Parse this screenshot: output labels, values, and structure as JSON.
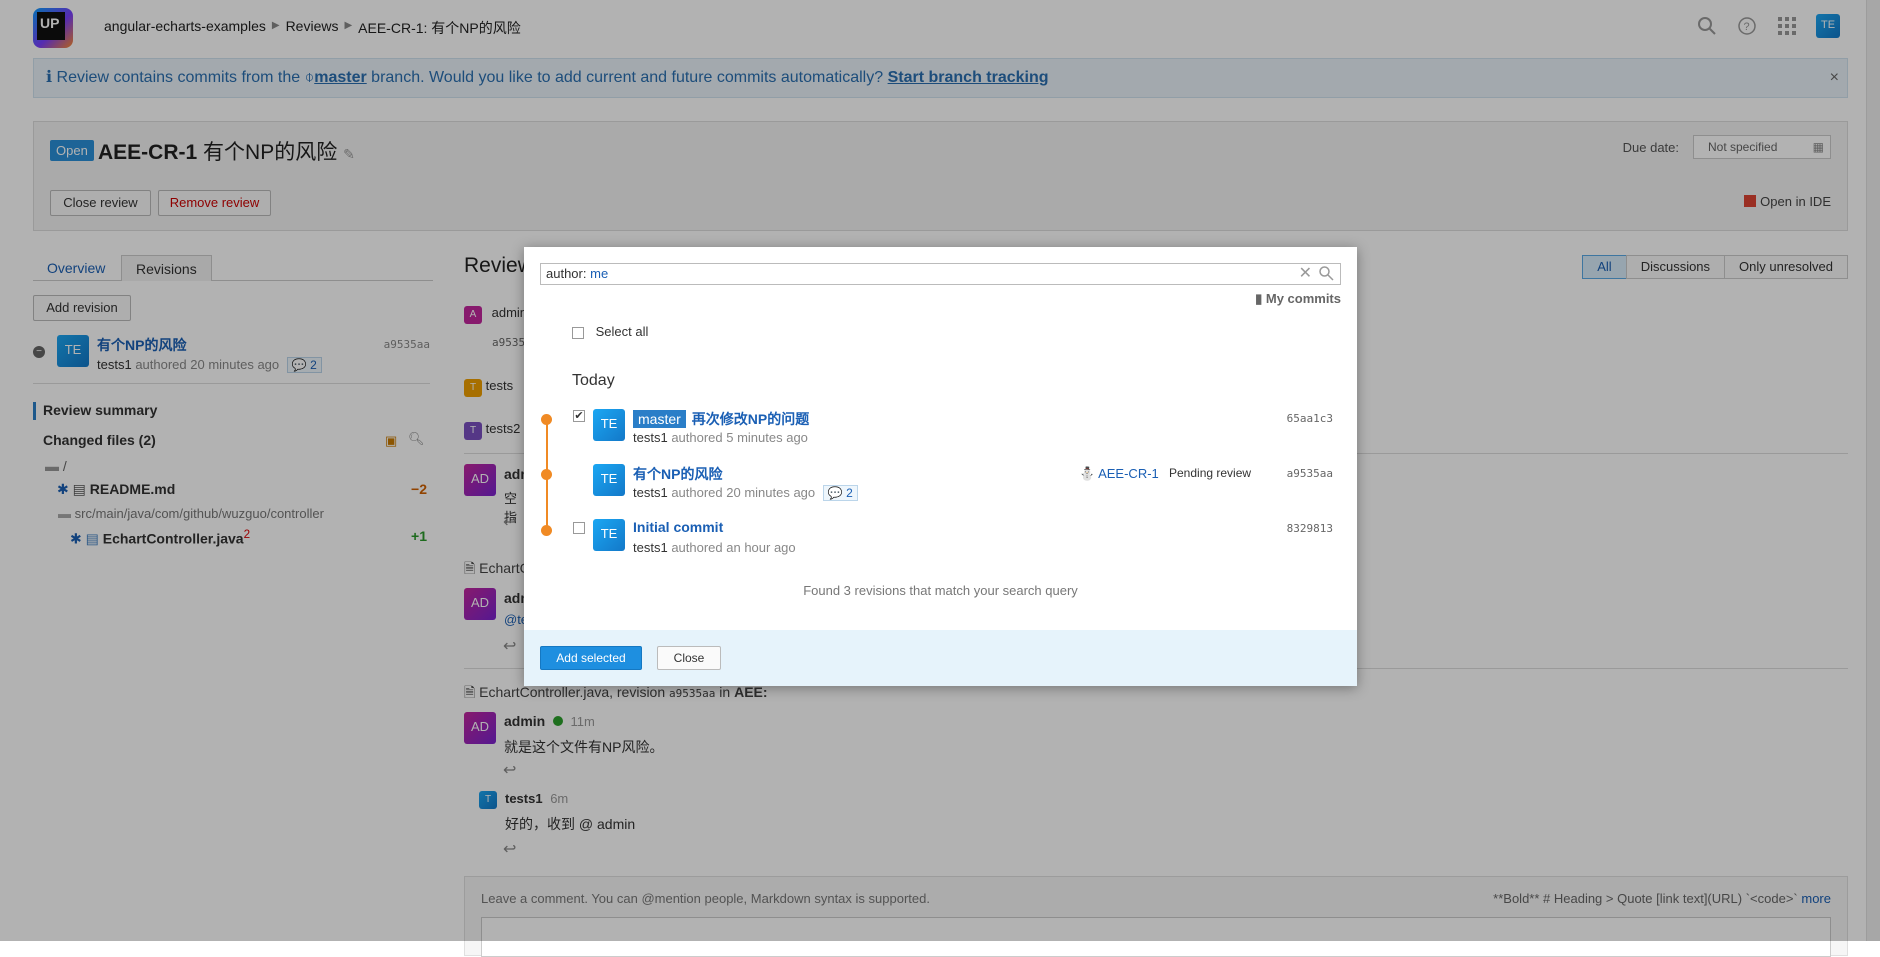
{
  "topbar": {
    "logo": "UP",
    "breadcrumb": [
      "angular-echarts-examples",
      "Reviews",
      "AEE-CR-1: 有个NP的风险"
    ],
    "user_avatar": "TE",
    "icons": [
      "search-icon",
      "help-icon",
      "apps-grid-icon"
    ]
  },
  "banner": {
    "text_before": "Review contains commits from the",
    "branch": "master",
    "text_after": "branch. Would you like to add current and future commits automatically?",
    "action": "Start branch tracking",
    "close": "×"
  },
  "review": {
    "status": "Open",
    "id": "AEE-CR-1",
    "title": "有个NP的风险",
    "due_label": "Due date:",
    "due_value": "Not specified",
    "close_btn": "Close review",
    "remove_btn": "Remove review",
    "open_ide": "Open in IDE"
  },
  "left": {
    "tabs": [
      "Overview",
      "Revisions"
    ],
    "add_revision": "Add revision",
    "revision": {
      "avatar": "TE",
      "title": "有个NP的风险",
      "hash": "a9535aa",
      "author": "tests1",
      "meta": "authored 20 minutes ago",
      "discussions": "2"
    },
    "review_summary": "Review summary",
    "changed_files": "Changed files (2)",
    "root": "/",
    "files": [
      {
        "name": "README.md",
        "delta": "−2"
      },
      {
        "dir": "src/main/java/com/github/wuzguo/controller"
      },
      {
        "name": "EchartController.java",
        "sup": "2",
        "delta": "+1"
      }
    ]
  },
  "center": {
    "heading": "Review",
    "filters": [
      "All",
      "Discussions",
      "Only unresolved"
    ],
    "partial": {
      "a1": "admin",
      "a1_hash": "a9535",
      "t1": "tests",
      "t2": "tests2",
      "ad1": "admi",
      "ad1_text": "空指",
      "file_ref_partial": "EchartC",
      "ad2": "admi",
      "ad2_text": "@te"
    },
    "file_ref": {
      "name": "EchartController.java",
      "middle": ", revision",
      "hash": "a9535aa",
      "in": "in",
      "project": "AEE:"
    },
    "comment1": {
      "avatar": "AD",
      "author": "admin",
      "time": "11m",
      "text": "就是这个文件有NP风险。"
    },
    "comment2": {
      "avatar": "T",
      "author": "tests1",
      "time": "6m",
      "text": "好的，收到 @ admin"
    },
    "comment_box": {
      "hint": "Leave a comment. You can @mention people, Markdown syntax is supported.",
      "md_help": "**Bold**  # Heading  > Quote  [link text](URL)  `<code>`",
      "more": "more"
    }
  },
  "modal": {
    "search_prefix": "author:",
    "search_value": "me",
    "my_commits": "My commits",
    "select_all": "Select all",
    "group": "Today",
    "revisions": [
      {
        "checked": true,
        "branch": "master",
        "title": "再次修改NP的问题",
        "author": "tests1",
        "meta": "authored 5 minutes ago",
        "hash": "65aa1c3"
      },
      {
        "checked": null,
        "title": "有个NP的风险",
        "author": "tests1",
        "meta": "authored 20 minutes ago",
        "discussions": "2",
        "review": "AEE-CR-1",
        "review_status": "Pending review",
        "hash": "a9535aa"
      },
      {
        "checked": false,
        "title": "Initial commit",
        "author": "tests1",
        "meta": "authored an hour ago",
        "hash": "8329813"
      }
    ],
    "found": "Found 3 revisions that match your search query",
    "add_selected": "Add selected",
    "close": "Close"
  },
  "colors": {
    "accent": "#1e8fe0",
    "timeline": "#f08a24",
    "link": "#1a5fb4"
  }
}
